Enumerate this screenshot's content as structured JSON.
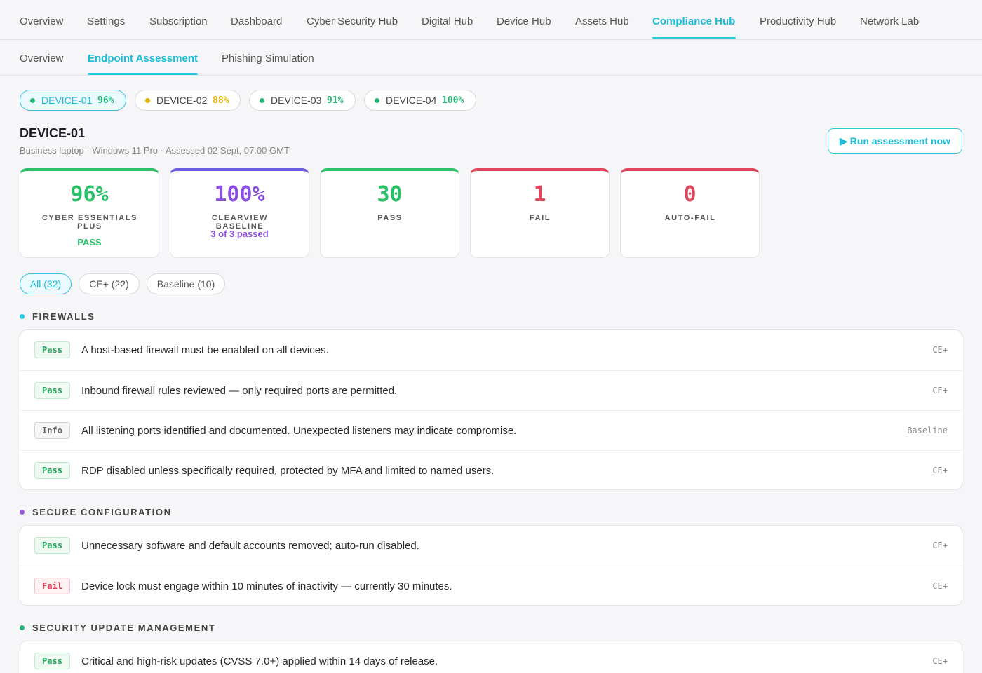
{
  "top_nav": [
    {
      "label": "Overview"
    },
    {
      "label": "Settings"
    },
    {
      "label": "Subscription"
    },
    {
      "label": "Dashboard"
    },
    {
      "label": "Cyber Security Hub"
    },
    {
      "label": "Digital Hub"
    },
    {
      "label": "Device Hub"
    },
    {
      "label": "Assets Hub"
    },
    {
      "label": "Compliance Hub",
      "active": true
    },
    {
      "label": "Productivity Hub"
    },
    {
      "label": "Network Lab"
    }
  ],
  "sub_nav": [
    {
      "label": "Overview"
    },
    {
      "label": "Endpoint Assessment",
      "active": true
    },
    {
      "label": "Phishing Simulation"
    }
  ],
  "devices": [
    {
      "name": "DEVICE-01",
      "score": "96%",
      "dot_color": "#22b573",
      "score_color": "#22b573",
      "active": true
    },
    {
      "name": "DEVICE-02",
      "score": "88%",
      "dot_color": "#e0b400",
      "score_color": "#e0b400"
    },
    {
      "name": "DEVICE-03",
      "score": "91%",
      "dot_color": "#22b573",
      "score_color": "#22b573"
    },
    {
      "name": "DEVICE-04",
      "score": "100%",
      "dot_color": "#22b573",
      "score_color": "#22b573"
    }
  ],
  "device": {
    "title": "DEVICE-01",
    "subtitle": "Business laptop · Windows 11 Pro · Assessed 02 Sept, 07:00 GMT",
    "run_label": "▶ Run assessment now"
  },
  "cards": [
    {
      "value": "96%",
      "caption": "CYBER ESSENTIALS PLUS",
      "note": "PASS",
      "accent": "#2bbf67",
      "value_color": "#2bbf67",
      "note_color": "#2bbf67"
    },
    {
      "value": "100%",
      "caption": "CLEARVIEW BASELINE",
      "note": "3 of 3 passed",
      "accent": "#6b5ce0",
      "value_color": "#8a4fe0",
      "note_color": "#8a4fe0"
    },
    {
      "value": "30",
      "caption": "PASS",
      "accent": "#2bbf67",
      "value_color": "#2bbf67"
    },
    {
      "value": "1",
      "caption": "FAIL",
      "accent": "#e0475e",
      "value_color": "#e0475e"
    },
    {
      "value": "0",
      "caption": "AUTO-FAIL",
      "accent": "#e0475e",
      "value_color": "#e0475e"
    }
  ],
  "filters": [
    {
      "label": "All (32)",
      "active": true
    },
    {
      "label": "CE+ (22)"
    },
    {
      "label": "Baseline (10)"
    }
  ],
  "sections": [
    {
      "title": "FIREWALLS",
      "dot_color": "#2ec7e0",
      "rows": [
        {
          "status": "Pass",
          "text": "A host-based firewall must be enabled on all devices.",
          "tag": "CE+"
        },
        {
          "status": "Pass",
          "text": "Inbound firewall rules reviewed — only required ports are permitted.",
          "tag": "CE+"
        },
        {
          "status": "Info",
          "text": "All listening ports identified and documented. Unexpected listeners may indicate compromise.",
          "tag": "Baseline"
        },
        {
          "status": "Pass",
          "text": "RDP disabled unless specifically required, protected by MFA and limited to named users.",
          "tag": "CE+"
        }
      ]
    },
    {
      "title": "SECURE CONFIGURATION",
      "dot_color": "#9b59e0",
      "rows": [
        {
          "status": "Pass",
          "text": "Unnecessary software and default accounts removed; auto-run disabled.",
          "tag": "CE+"
        },
        {
          "status": "Fail",
          "text": "Device lock must engage within 10 minutes of inactivity — currently 30 minutes.",
          "tag": "CE+"
        }
      ]
    },
    {
      "title": "SECURITY UPDATE MANAGEMENT",
      "dot_color": "#22b573",
      "rows": [
        {
          "status": "Pass",
          "text": "Critical and high-risk updates (CVSS 7.0+) applied within 14 days of release.",
          "tag": "CE+"
        }
      ]
    }
  ]
}
